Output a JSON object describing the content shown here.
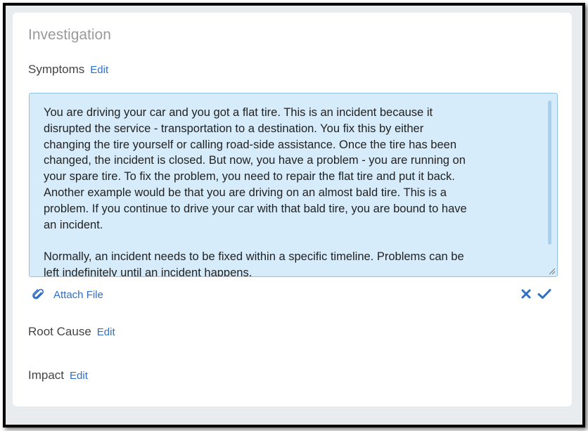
{
  "section": {
    "title": "Investigation"
  },
  "symptoms": {
    "label": "Symptoms",
    "edit_label": "Edit",
    "text": "You are driving your car and you got a flat tire. This is an incident because it\ndisrupted the service - transportation to a destination. You fix this by either\nchanging the tire yourself or calling road-side assistance. Once the tire has been\nchanged, the incident is closed. But now, you have a problem - you are running on\nyour spare tire. To fix the problem, you need to repair the flat tire and put it back.\nAnother example would be that you are driving on an almost bald tire. This is a\nproblem. If you continue to drive your car with that bald tire, you are bound to have\nan incident.\n\nNormally, an incident needs to be fixed within a specific timeline. Problems can be\nleft indefinitely until an incident happens."
  },
  "attach": {
    "label": "Attach File",
    "icon": "paperclip-icon"
  },
  "actions": {
    "cancel_icon": "close-icon",
    "confirm_icon": "check-icon",
    "color": "#2f6ec6"
  },
  "root_cause": {
    "label": "Root Cause",
    "edit_label": "Edit"
  },
  "impact": {
    "label": "Impact",
    "edit_label": "Edit"
  }
}
